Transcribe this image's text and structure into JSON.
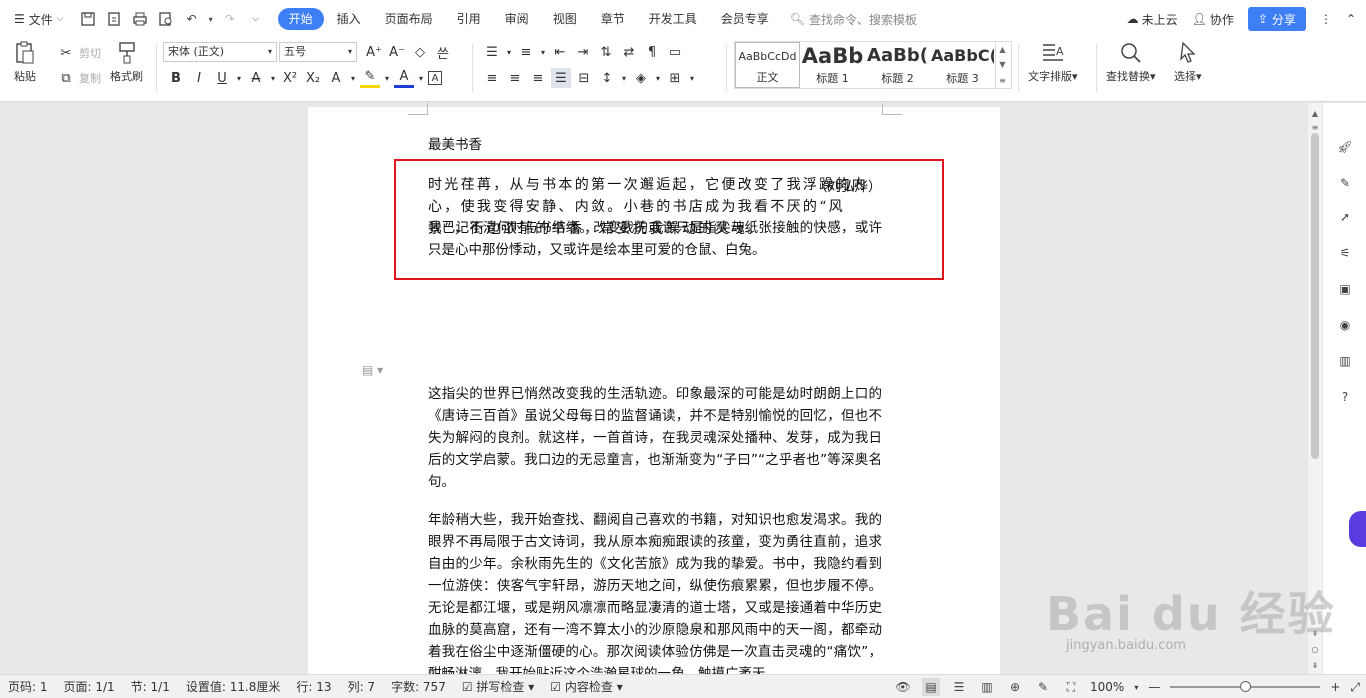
{
  "menubar": {
    "file_label": "文件",
    "tabs": [
      "开始",
      "插入",
      "页面布局",
      "引用",
      "审阅",
      "视图",
      "章节",
      "开发工具",
      "会员专享"
    ],
    "search_placeholder": "查找命令、搜索模板",
    "cloud_label": "未上云",
    "collab_label": "协作",
    "share_label": "分享"
  },
  "ribbon": {
    "paste": "粘贴",
    "cut": "剪切",
    "copy": "复制",
    "format_painter": "格式刷",
    "font_name": "宋体 (正文)",
    "font_size": "五号",
    "styles": [
      {
        "sample": "AaBbCcDd",
        "name": "正文"
      },
      {
        "sample": "AaBb",
        "name": "标题 1"
      },
      {
        "sample": "AaBb(",
        "name": "标题 2"
      },
      {
        "sample": "AaBbC(",
        "name": "标题 3"
      }
    ],
    "text_layout": "文字排版",
    "find_replace": "查找替换",
    "select": "选择"
  },
  "document": {
    "title": "最美书香",
    "author": "（刘弘烨）",
    "p1": "我已记不清何时与书结缘。改变我的或许只是指尖与纸张接触的快感，或许只是心中那份悸动，又或许是绘本里可爱的仓鼠、白兔。",
    "highlighted": "时光荏苒，从与书本的第一次邂逅起，它便改变了我浮躁的内心，使我变得安静、内敛。小巷的书店成为我看不厌的“风景”，街边浓郁的书香，常安抚我躁动的灵魂。",
    "p2": "这指尖的世界已悄然改变我的生活轨迹。印象最深的可能是幼时朗朗上口的《唐诗三百首》虽说父母每日的监督诵读，并不是特别愉悦的回忆，但也不失为解闷的良剂。就这样，一首首诗，在我灵魂深处播种、发芽，成为我日后的文学启蒙。我口边的无忌童言，也渐渐变为“子曰”“之乎者也”等深奥名句。",
    "p3": "年龄稍大些，我开始查找、翻阅自己喜欢的书籍，对知识也愈发渴求。我的眼界不再局限于古文诗词，我从原本痴痴跟读的孩童，变为勇往直前，追求自由的少年。余秋雨先生的《文化苦旅》成为我的挚爱。书中，我隐约看到一位游侠：侠客气宇轩昂，游历天地之间，纵使伤痕累累，但也步履不停。无论是都江堰，或是朔风凛凛而略显凄清的道士塔，又或是接通着中华历史血脉的莫高窟，还有一湾不算太小的沙原隐泉和那风雨中的天一阁，都牵动着我在俗尘中逐渐僵硬的心。那次阅读体验仿佛是一次直击灵魂的“痛饮”，酣畅淋漓。我开始贴近这个浩瀚星球的一角，触摸广袤天"
  },
  "watermark": {
    "logo": "Bai du 经验",
    "url": "jingyan.baidu.com"
  },
  "status": {
    "page_num": "页码: 1",
    "pages": "页面: 1/1",
    "section": "节: 1/1",
    "setting": "设置值: 11.8厘米",
    "line": "行: 13",
    "col": "列: 7",
    "words": "字数: 757",
    "spell": "拼写检查",
    "content": "内容检查",
    "zoom": "100%"
  },
  "colors": {
    "accent": "#3f7ff5",
    "highlight_border": "#e0141f"
  }
}
